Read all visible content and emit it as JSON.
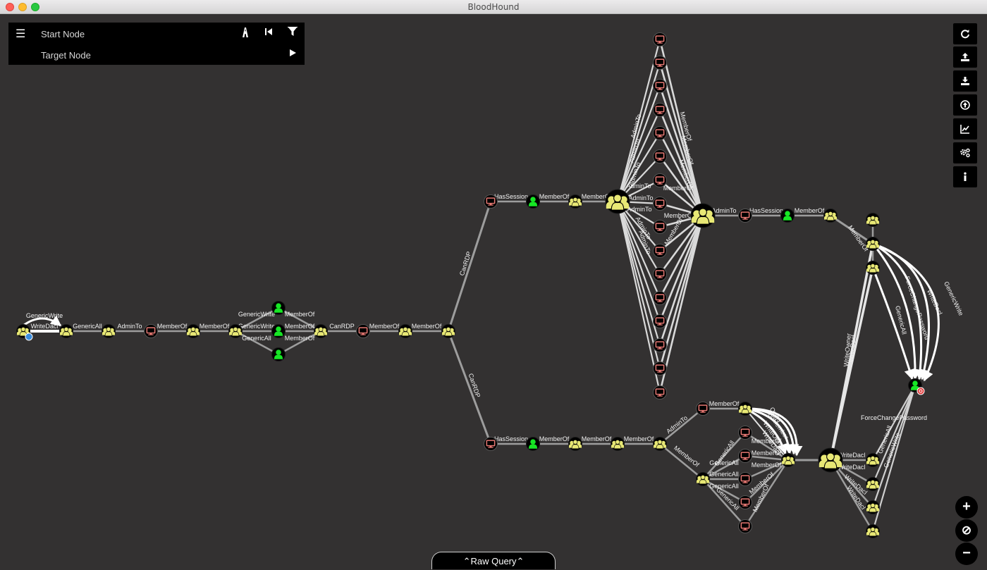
{
  "window": {
    "title": "BloodHound"
  },
  "search": {
    "start_placeholder": "Start Node",
    "target_placeholder": "Target Node",
    "menu_icon": "hamburger-menu-icon",
    "pathfind_icon": "road-icon",
    "back_icon": "step-backward-icon",
    "filter_icon": "filter-icon",
    "play_icon": "play-icon"
  },
  "toolbar": {
    "buttons": [
      {
        "name": "refresh-icon",
        "glyph": "⟳"
      },
      {
        "name": "export-icon",
        "glyph": "⇪"
      },
      {
        "name": "import-icon",
        "glyph": "⤓"
      },
      {
        "name": "upload-icon",
        "glyph": "⬆"
      },
      {
        "name": "chart-icon",
        "glyph": "📈"
      },
      {
        "name": "settings-icon",
        "glyph": "⚙"
      },
      {
        "name": "info-icon",
        "glyph": "ℹ"
      }
    ]
  },
  "zoom": {
    "zoom_in": "+",
    "reset": "⊘",
    "zoom_out": "−"
  },
  "raw_query": {
    "label": "⌃Raw Query⌃"
  },
  "colors": {
    "group": "#e8e875",
    "user": "#17e625",
    "computer": "#e67873",
    "edge": "#9d9d9d",
    "background": "#333131"
  },
  "edge_labels": [
    "GenericWrite",
    "WriteDacl",
    "GenericAll",
    "AdminTo",
    "MemberOf",
    "MemberOf",
    "GenericWrite",
    "GenericWrite",
    "GenericAll",
    "MemberOf",
    "MemberOf",
    "MemberOf",
    "CanRDP",
    "MemberOf",
    "MemberOf",
    "CanRDP",
    "CanRDP",
    "HasSession",
    "MemberOf",
    "MemberOf",
    "AdminTo",
    "AdminTo",
    "AdminTo",
    "AdminTo",
    "AdminTo",
    "AdminTo",
    "AdminTo",
    "AdminTo",
    "MemberOf",
    "MemberOf",
    "MemberOf",
    "MemberOf",
    "MemberOf",
    "MemberOf",
    "AdminTo",
    "HasSession",
    "MemberOf",
    "MemberOf",
    "ForceChangePassword",
    "GenericAll",
    "WriteDacl",
    "GenericWrite",
    "HasSession",
    "MemberOf",
    "MemberOf",
    "MemberOf",
    "AdminTo",
    "MemberOf",
    "MemberOf",
    "Owns",
    "AddMember",
    "WriteOwner",
    "WriteDacl",
    "MemberOf",
    "MemberOf",
    "GenericAll",
    "GenericAll",
    "GenericAll",
    "GenericAll",
    "GenericAll",
    "MemberOf",
    "MemberOf",
    "MemberOf",
    "WriteDacl",
    "WriteDacl",
    "WriteDacl",
    "WriteDacl",
    "WriteOwner",
    "WriteDacl",
    "ForceChangePassword",
    "GenericAll",
    "GenericWrite"
  ]
}
